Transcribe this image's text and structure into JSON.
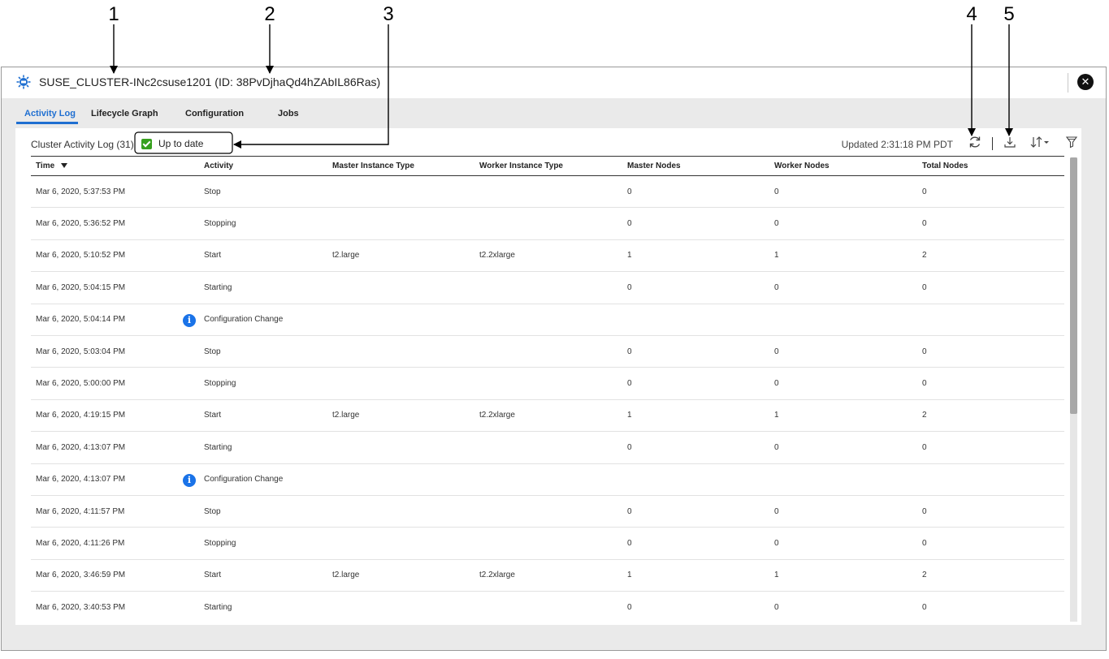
{
  "callouts": [
    "1",
    "2",
    "3",
    "4",
    "5"
  ],
  "dialog": {
    "title": "SUSE_CLUSTER-INc2csuse1201 (ID: 38PvDjhaQd4hZAbIL86Ras)",
    "icon": "cluster-icon",
    "close_icon": "close-icon"
  },
  "tabs": [
    {
      "label": "Activity Log",
      "active": true
    },
    {
      "label": "Lifecycle Graph",
      "active": false
    },
    {
      "label": "Configuration",
      "active": false
    },
    {
      "label": "Jobs",
      "active": false
    }
  ],
  "panel": {
    "title": "Cluster Activity Log (31)",
    "status": "Up to date",
    "updated": "Updated 2:31:18 PM PDT",
    "toolbar_icons": [
      "refresh-icon",
      "download-icon",
      "sort-icon",
      "filter-icon"
    ]
  },
  "table": {
    "columns": [
      "Time",
      "Activity",
      "Master Instance Type",
      "Worker Instance Type",
      "Master Nodes",
      "Worker Nodes",
      "Total Nodes"
    ],
    "rows": [
      {
        "time": "Mar 6, 2020, 5:37:53 PM",
        "activity": "Stop",
        "master_type": "",
        "worker_type": "",
        "master_nodes": "0",
        "worker_nodes": "0",
        "total_nodes": "0",
        "info": false
      },
      {
        "time": "Mar 6, 2020, 5:36:52 PM",
        "activity": "Stopping",
        "master_type": "",
        "worker_type": "",
        "master_nodes": "0",
        "worker_nodes": "0",
        "total_nodes": "0",
        "info": false
      },
      {
        "time": "Mar 6, 2020, 5:10:52 PM",
        "activity": "Start",
        "master_type": "t2.large",
        "worker_type": "t2.2xlarge",
        "master_nodes": "1",
        "worker_nodes": "1",
        "total_nodes": "2",
        "info": false
      },
      {
        "time": "Mar 6, 2020, 5:04:15 PM",
        "activity": "Starting",
        "master_type": "",
        "worker_type": "",
        "master_nodes": "0",
        "worker_nodes": "0",
        "total_nodes": "0",
        "info": false
      },
      {
        "time": "Mar 6, 2020, 5:04:14 PM",
        "activity": "Configuration Change",
        "master_type": "",
        "worker_type": "",
        "master_nodes": "",
        "worker_nodes": "",
        "total_nodes": "",
        "info": true
      },
      {
        "time": "Mar 6, 2020, 5:03:04 PM",
        "activity": "Stop",
        "master_type": "",
        "worker_type": "",
        "master_nodes": "0",
        "worker_nodes": "0",
        "total_nodes": "0",
        "info": false
      },
      {
        "time": "Mar 6, 2020, 5:00:00 PM",
        "activity": "Stopping",
        "master_type": "",
        "worker_type": "",
        "master_nodes": "0",
        "worker_nodes": "0",
        "total_nodes": "0",
        "info": false
      },
      {
        "time": "Mar 6, 2020, 4:19:15 PM",
        "activity": "Start",
        "master_type": "t2.large",
        "worker_type": "t2.2xlarge",
        "master_nodes": "1",
        "worker_nodes": "1",
        "total_nodes": "2",
        "info": false
      },
      {
        "time": "Mar 6, 2020, 4:13:07 PM",
        "activity": "Starting",
        "master_type": "",
        "worker_type": "",
        "master_nodes": "0",
        "worker_nodes": "0",
        "total_nodes": "0",
        "info": false
      },
      {
        "time": "Mar 6, 2020, 4:13:07 PM",
        "activity": "Configuration Change",
        "master_type": "",
        "worker_type": "",
        "master_nodes": "",
        "worker_nodes": "",
        "total_nodes": "",
        "info": true
      },
      {
        "time": "Mar 6, 2020, 4:11:57 PM",
        "activity": "Stop",
        "master_type": "",
        "worker_type": "",
        "master_nodes": "0",
        "worker_nodes": "0",
        "total_nodes": "0",
        "info": false
      },
      {
        "time": "Mar 6, 2020, 4:11:26 PM",
        "activity": "Stopping",
        "master_type": "",
        "worker_type": "",
        "master_nodes": "0",
        "worker_nodes": "0",
        "total_nodes": "0",
        "info": false
      },
      {
        "time": "Mar 6, 2020, 3:46:59 PM",
        "activity": "Start",
        "master_type": "t2.large",
        "worker_type": "t2.2xlarge",
        "master_nodes": "1",
        "worker_nodes": "1",
        "total_nodes": "2",
        "info": false
      },
      {
        "time": "Mar 6, 2020, 3:40:53 PM",
        "activity": "Starting",
        "master_type": "",
        "worker_type": "",
        "master_nodes": "0",
        "worker_nodes": "0",
        "total_nodes": "0",
        "info": false
      }
    ]
  },
  "colors": {
    "accent": "#1f6fd1",
    "status_ok": "#37a01e",
    "info": "#1a73e8"
  }
}
